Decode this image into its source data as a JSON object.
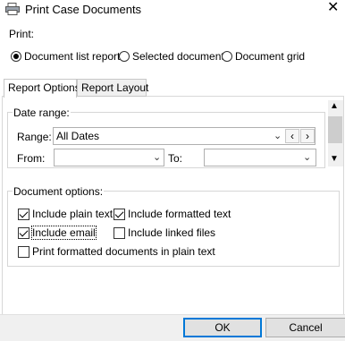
{
  "window": {
    "title": "Print Case Documents",
    "close_glyph": "✕",
    "app_icon": "printer-icon"
  },
  "print": {
    "label": "Print:",
    "options": [
      {
        "label": "Document list report",
        "checked": true
      },
      {
        "label": "Selected document",
        "checked": false
      },
      {
        "label": "Document grid",
        "checked": false
      }
    ]
  },
  "tabs": [
    {
      "label": "Report Options",
      "active": true
    },
    {
      "label": "Report Layout",
      "active": false
    }
  ],
  "date_range": {
    "group_label": "Date range:",
    "range_label": "Range:",
    "range_value": "All Dates",
    "prev_glyph": "‹",
    "next_glyph": "›",
    "from_label": "From:",
    "to_label": "To:",
    "from_value": "",
    "to_value": ""
  },
  "doc_options": {
    "group_label": "Document options:",
    "items": [
      {
        "label": "Include plain text",
        "checked": true
      },
      {
        "label": "Include formatted text",
        "checked": true
      },
      {
        "label": "Include email",
        "checked": true
      },
      {
        "label": "Include linked files",
        "checked": false
      },
      {
        "label": "Print formatted documents in plain text",
        "checked": false
      }
    ]
  },
  "buttons": {
    "ok": "OK",
    "cancel": "Cancel"
  }
}
